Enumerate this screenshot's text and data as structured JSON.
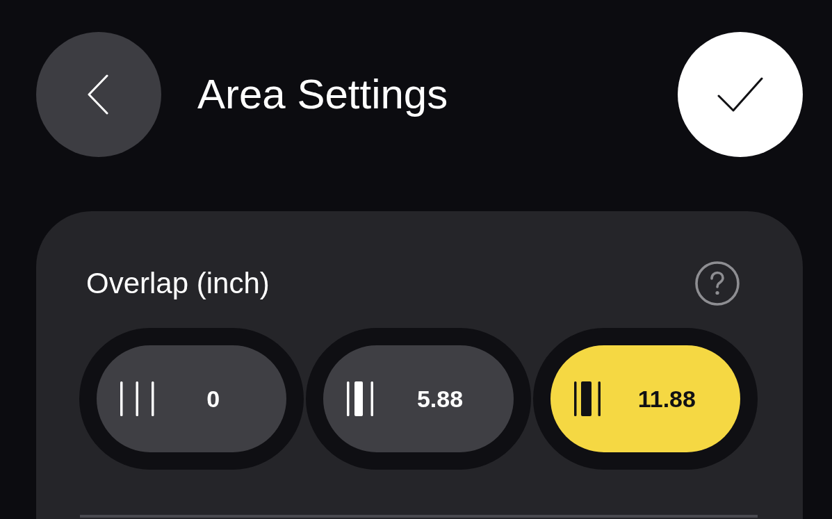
{
  "header": {
    "title": "Area Settings"
  },
  "overlap": {
    "label": "Overlap (inch)",
    "options": [
      {
        "value": "0",
        "kind": "thin",
        "selected": false
      },
      {
        "value": "5.88",
        "kind": "medium",
        "selected": false
      },
      {
        "value": "11.88",
        "kind": "wide",
        "selected": true
      }
    ]
  }
}
